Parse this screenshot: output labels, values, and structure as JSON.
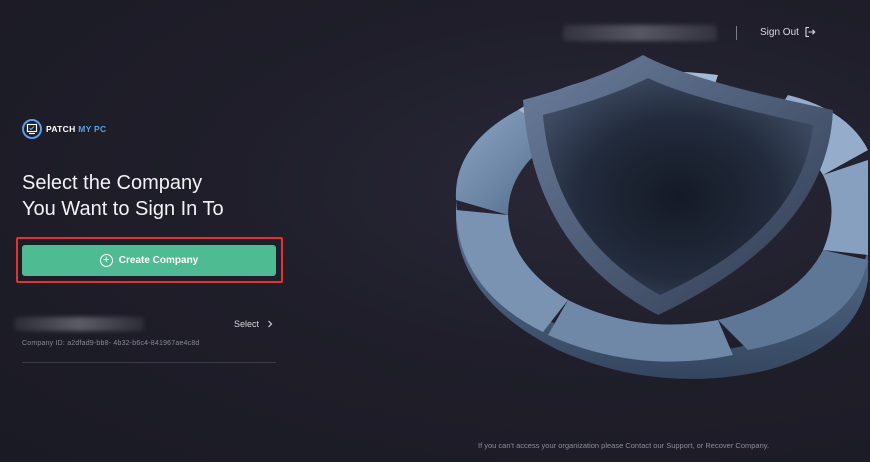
{
  "header": {
    "user_display": "",
    "signout_label": "Sign Out"
  },
  "brand": {
    "name_primary": "PATCH",
    "name_secondary": "MY PC",
    "accent_color": "#5aa0e6"
  },
  "main": {
    "title_line1": "Select the Company",
    "title_line2": "You Want to Sign In To",
    "create_button_label": "Create Company",
    "create_button_color": "#4fbb92"
  },
  "companies": [
    {
      "name": "",
      "select_label": "Select",
      "id_text": "Company ID: a2dfad9-bb8- 4b32-b6c4-841967ae4c8d"
    }
  ],
  "footer": {
    "note": "If you can't access your organization please Contact our Support, or Recover Company."
  },
  "icons": {
    "signout": "sign-out-arrow-icon",
    "plus": "plus-circle-icon",
    "chevron": "chevron-right-icon",
    "logo": "patch-my-pc-logo"
  }
}
